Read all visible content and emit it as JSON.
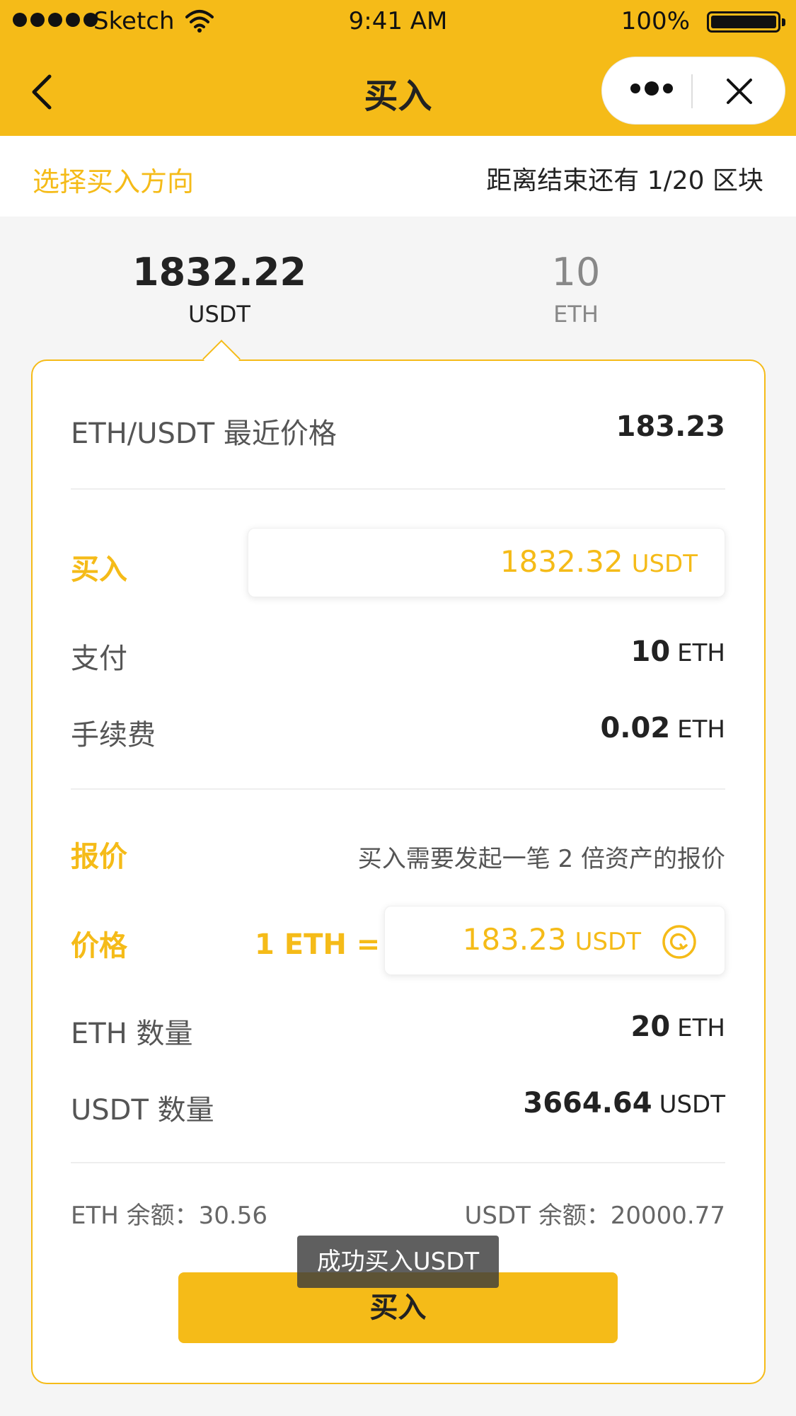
{
  "status_bar": {
    "carrier": "Sketch",
    "time": "9:41 AM",
    "battery": "100%"
  },
  "nav": {
    "title": "买入"
  },
  "direction": {
    "left_label": "选择买入方向",
    "right_label": "距离结束还有 1/20 区块"
  },
  "tabs": [
    {
      "amount": "1832.22",
      "unit": "USDT",
      "active": true
    },
    {
      "amount": "10",
      "unit": "ETH",
      "active": false
    }
  ],
  "card": {
    "recent_price": {
      "label": "ETH/USDT 最近价格",
      "value": "183.23"
    },
    "buy": {
      "label": "买入",
      "amount": "1832.32",
      "unit": "USDT"
    },
    "pay": {
      "label": "支付",
      "amount": "10",
      "unit": "ETH"
    },
    "fee": {
      "label": "手续费",
      "amount": "0.02",
      "unit": "ETH"
    },
    "quote": {
      "label": "报价",
      "note": "买入需要发起一笔 2 倍资产的报价"
    },
    "price": {
      "label": "价格",
      "eq": "1 ETH =",
      "amount": "183.23",
      "unit": "USDT"
    },
    "eth_qty": {
      "label": "ETH 数量",
      "amount": "20",
      "unit": "ETH"
    },
    "usdt_qty": {
      "label": "USDT 数量",
      "amount": "3664.64",
      "unit": "USDT"
    },
    "balances": {
      "eth": "ETH 余额：30.56",
      "usdt": "USDT 余额：20000.77"
    }
  },
  "buy_button": "买入",
  "toast": "成功买入USDT",
  "colors": {
    "accent": "#f5bb18",
    "text": "#222222",
    "muted": "#555555",
    "background": "#f5f5f5"
  },
  "icons": [
    "signal-icon",
    "wifi-icon",
    "battery-icon",
    "back-icon",
    "more-icon",
    "close-icon",
    "refresh-icon"
  ]
}
